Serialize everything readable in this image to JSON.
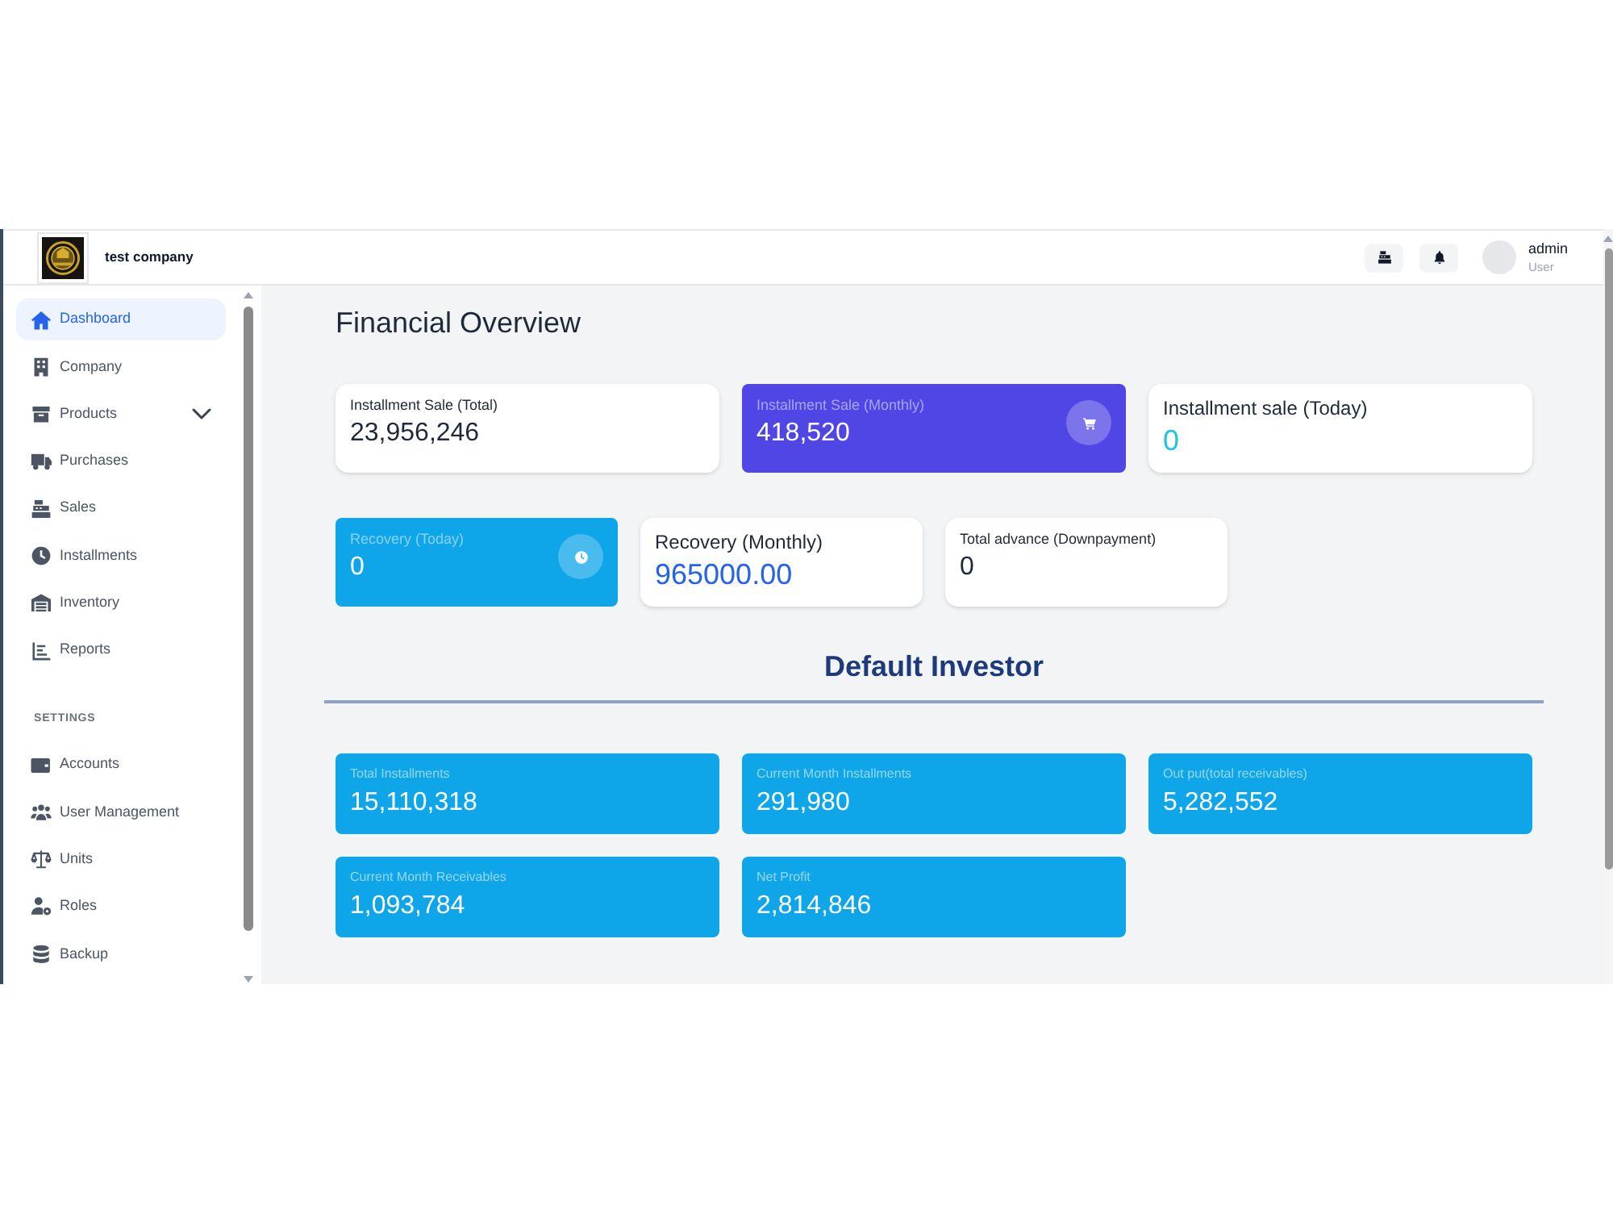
{
  "header": {
    "company_name": "test company",
    "user": {
      "name": "admin",
      "role": "User"
    }
  },
  "sidebar": {
    "items": [
      {
        "label": "Dashboard",
        "kind": "link",
        "selected": true
      },
      {
        "label": "Company",
        "kind": "link",
        "selected": false
      },
      {
        "label": "Products",
        "kind": "group",
        "selected": false
      },
      {
        "label": "Purchases",
        "kind": "link",
        "selected": false
      },
      {
        "label": "Sales",
        "kind": "link",
        "selected": false
      },
      {
        "label": "Installments",
        "kind": "link",
        "selected": false
      },
      {
        "label": "Inventory",
        "kind": "link",
        "selected": false
      },
      {
        "label": "Reports",
        "kind": "link",
        "selected": false
      }
    ],
    "settings": {
      "title": "SETTINGS",
      "items": [
        {
          "label": "Accounts",
          "selected": false
        },
        {
          "label": "User Management",
          "selected": false
        },
        {
          "label": "Units",
          "selected": false
        },
        {
          "label": "Roles",
          "selected": false
        },
        {
          "label": "Backup",
          "selected": false
        }
      ]
    }
  },
  "financial_overview": {
    "title": "Financial Overview",
    "rows": [
      {
        "cards": [
          {
            "kind": "plain",
            "label": "Installment Sale (Total)",
            "value": "23,956,246"
          },
          {
            "kind": "filled",
            "label": "Installment Sale (Monthly)",
            "value": "418,520",
            "color": "#4f46e5"
          },
          {
            "kind": "emphasis",
            "label": "Installment sale (Today)",
            "value": "0",
            "color": "#22c3e6"
          }
        ]
      },
      {
        "cards": [
          {
            "kind": "filled",
            "label": "Recovery (Today)",
            "value": "0",
            "color": "#0ea5e9"
          },
          {
            "kind": "emphasis",
            "label": "Recovery (Monthly)",
            "value": "965000.00",
            "color": "#2563eb"
          },
          {
            "kind": "plain",
            "label": "Total advance (Downpayment)",
            "value": "0"
          }
        ]
      }
    ]
  },
  "investor": {
    "title": "Default Investor",
    "cards": [
      {
        "label": "Total Installments",
        "value": "15,110,318"
      },
      {
        "label": "Current Month Installments",
        "value": "291,980"
      },
      {
        "label": "Out put(total receivables)",
        "value": "5,282,552"
      },
      {
        "label": "Current Month Receivables",
        "value": "1,093,784"
      },
      {
        "label": "Net Profit",
        "value": "2,814,846"
      }
    ]
  }
}
